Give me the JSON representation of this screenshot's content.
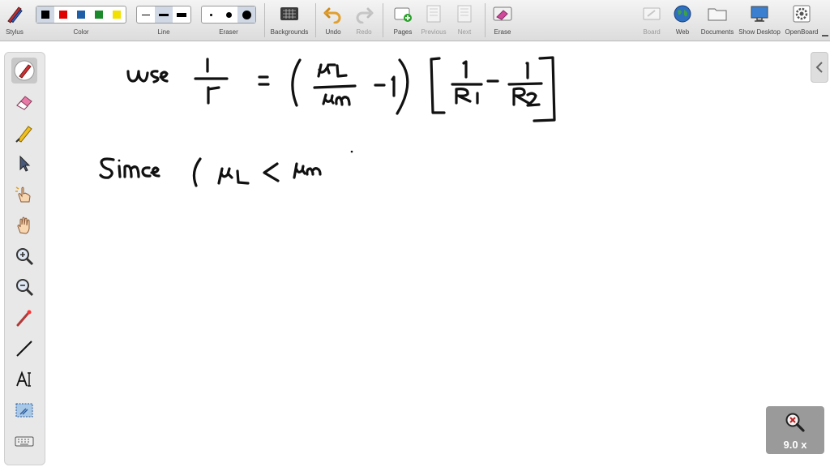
{
  "toolbar": {
    "stylus_label": "Stylus",
    "color_label": "Color",
    "line_label": "Line",
    "eraser_label": "Eraser",
    "backgrounds_label": "Backgrounds",
    "undo_label": "Undo",
    "redo_label": "Redo",
    "pages_label": "Pages",
    "previous_label": "Previous",
    "next_label": "Next",
    "erase_label": "Erase",
    "board_label": "Board",
    "web_label": "Web",
    "documents_label": "Documents",
    "show_desktop_label": "Show Desktop",
    "openboard_label": "OpenBoard",
    "colors": [
      "#000000",
      "#e00000",
      "#1f5fa8",
      "#1a8a2a",
      "#f2e000"
    ],
    "selected_color": "#000000"
  },
  "zoom": {
    "label": "9.0 x"
  },
  "left_tools": [
    "pen-icon",
    "eraser-icon",
    "marker-icon",
    "pointer-icon",
    "hand-interact-icon",
    "hand-pan-icon",
    "zoom-in-icon",
    "zoom-out-icon",
    "laser-pointer-icon",
    "line-icon",
    "text-icon",
    "capture-icon",
    "keyboard-icon"
  ],
  "board": {
    "line1": "use 1/f = (μL/μm − 1) [1/R1 − 1/R2]",
    "line2": "Since ( μL < μm"
  }
}
